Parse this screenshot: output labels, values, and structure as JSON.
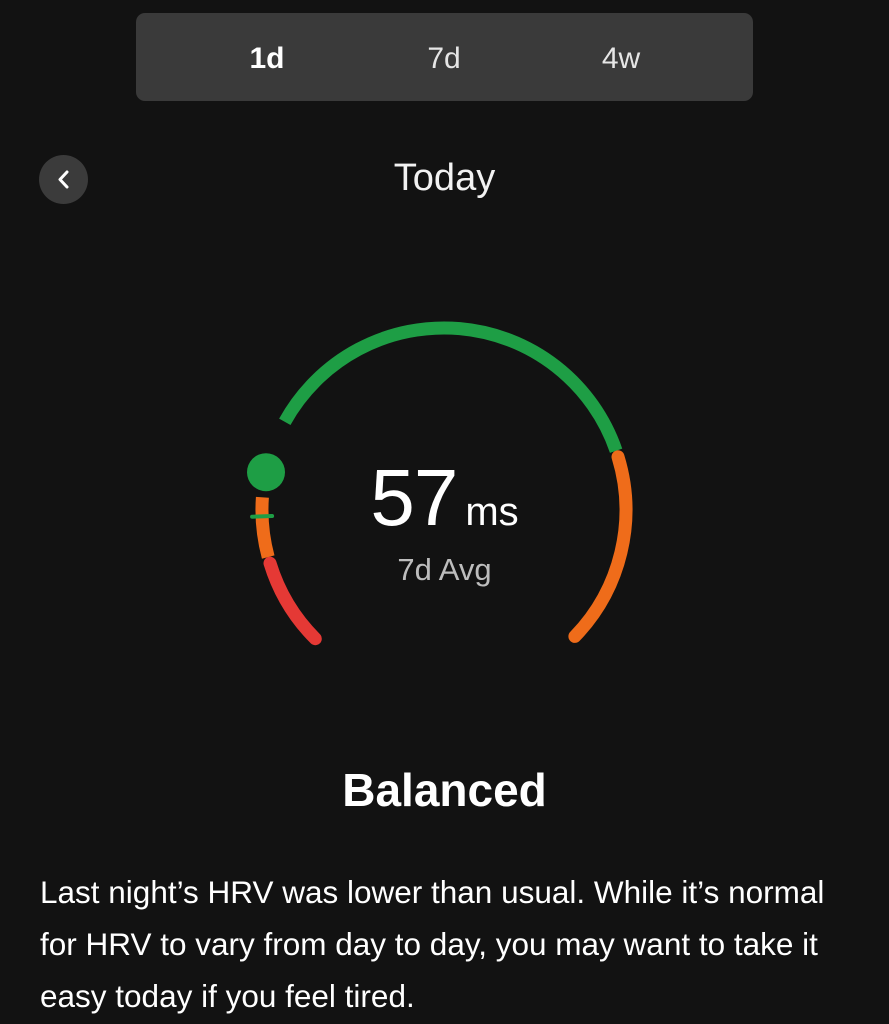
{
  "tabs": [
    {
      "label": "1d",
      "active": true
    },
    {
      "label": "7d",
      "active": false
    },
    {
      "label": "4w",
      "active": false
    }
  ],
  "header": {
    "back_icon": "chevron-left-icon",
    "title": "Today"
  },
  "gauge": {
    "value": "57",
    "unit": "ms",
    "sub_label": "7d Avg",
    "marker_icon": "position-dot-icon",
    "colors": {
      "low": "#e53935",
      "mid": "#ef6c1a",
      "balanced": "#1e9e45"
    }
  },
  "status": "Balanced",
  "description": "Last night’s HRV was lower than usual. While it’s normal for HRV to vary from day to day, you may want to take it easy today if you feel tired."
}
